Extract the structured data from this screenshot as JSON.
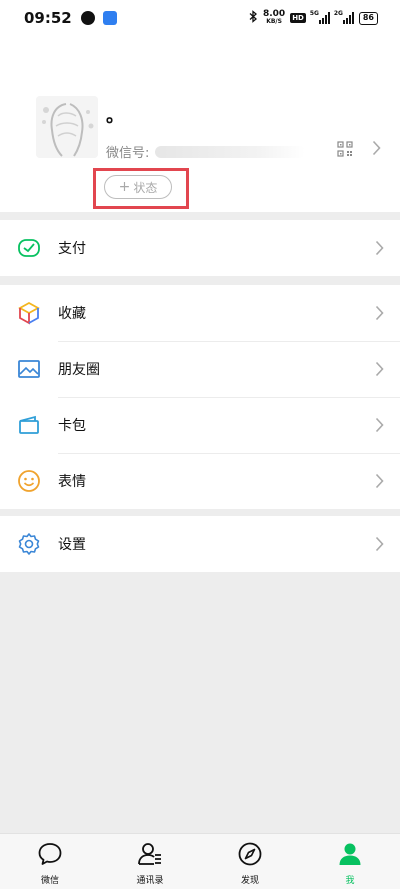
{
  "status_bar": {
    "time": "09:52",
    "net_speed_value": "8.00",
    "net_speed_unit": "KB/S",
    "hd_label": "HD",
    "signal1_label": "5G",
    "signal2_label": "2G",
    "battery": "86"
  },
  "profile": {
    "nickname": "。",
    "wechat_id_label": "微信号:",
    "status_button_label": "状态",
    "status_button_plus": "+"
  },
  "menu": {
    "pay": "支付",
    "favorites": "收藏",
    "moments": "朋友圈",
    "cards": "卡包",
    "stickers": "表情",
    "settings": "设置"
  },
  "tabbar": {
    "tabs": [
      {
        "label": "微信",
        "icon": "chat-bubble-icon"
      },
      {
        "label": "通讯录",
        "icon": "contacts-icon"
      },
      {
        "label": "发现",
        "icon": "compass-icon"
      },
      {
        "label": "我",
        "icon": "profile-person-icon"
      }
    ],
    "active_index": 3
  },
  "colors": {
    "accent_green": "#07c160",
    "highlight_red": "#e2464f",
    "background_gray": "#ededed"
  }
}
